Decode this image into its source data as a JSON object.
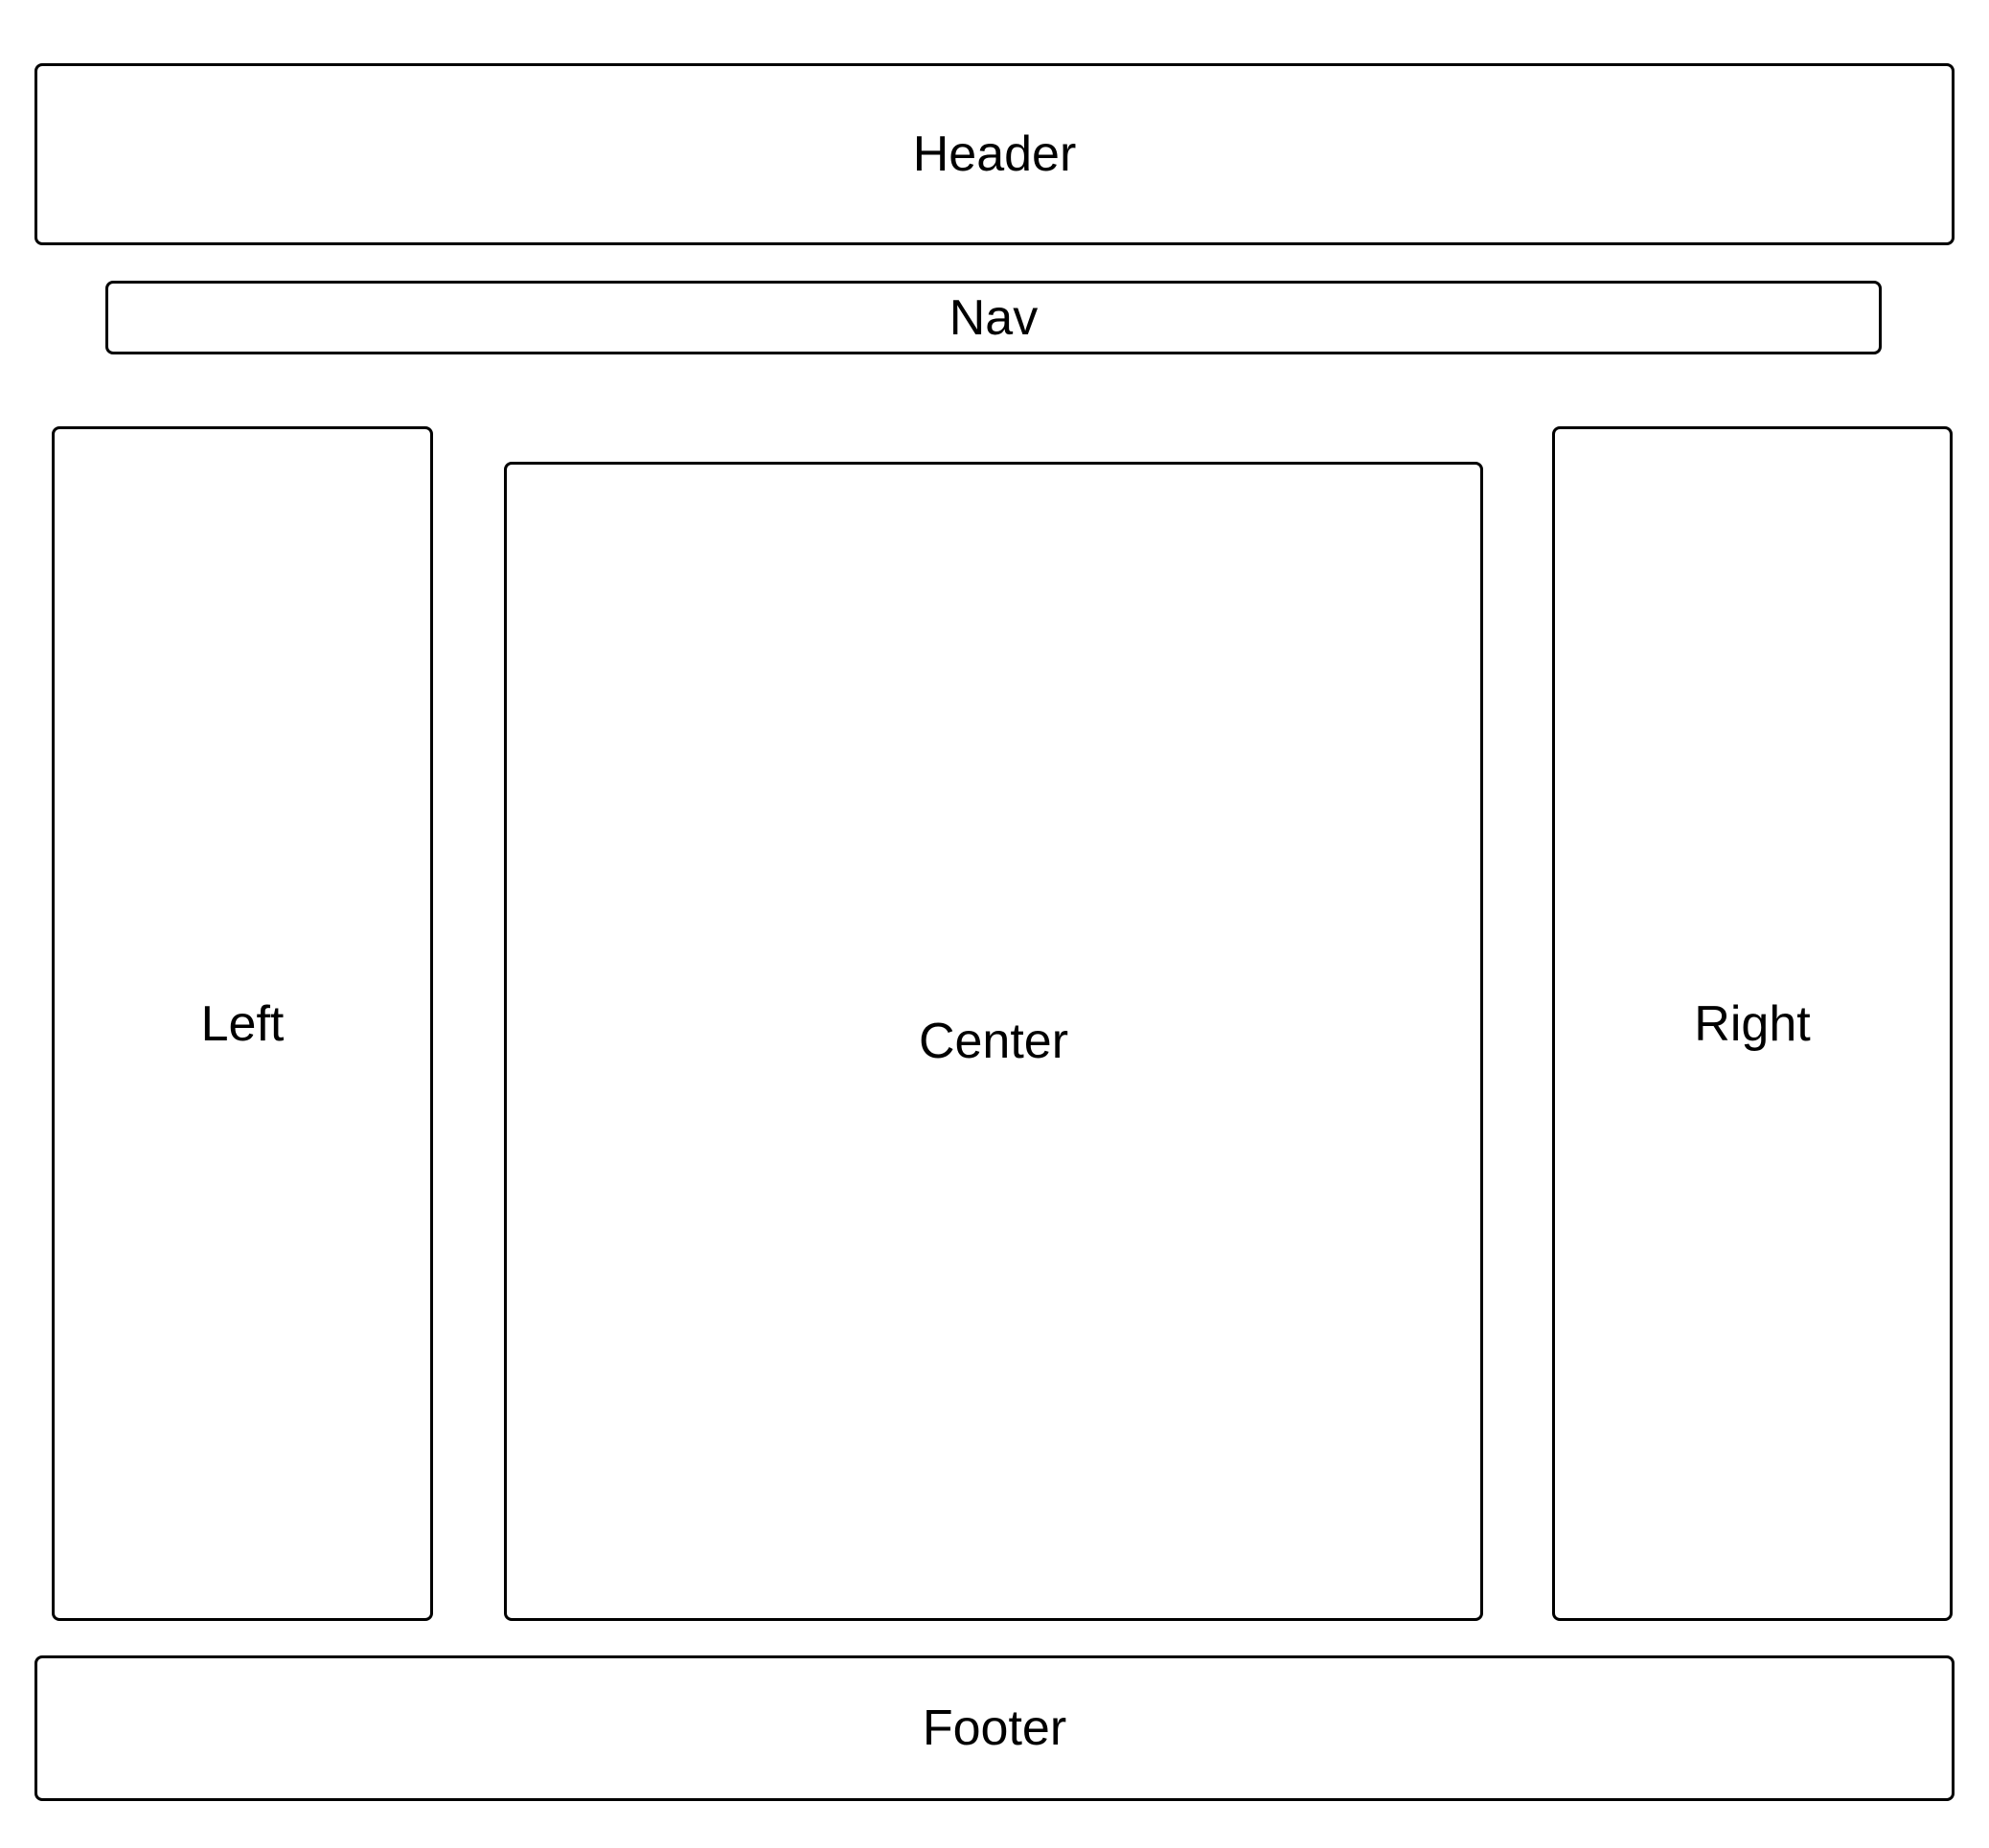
{
  "layout": {
    "header": {
      "label": "Header"
    },
    "nav": {
      "label": "Nav"
    },
    "left": {
      "label": "Left"
    },
    "center": {
      "label": "Center"
    },
    "right": {
      "label": "Right"
    },
    "footer": {
      "label": "Footer"
    }
  },
  "colors": {
    "background": "#ffffff",
    "stroke": "#000000",
    "text": "#000000"
  }
}
